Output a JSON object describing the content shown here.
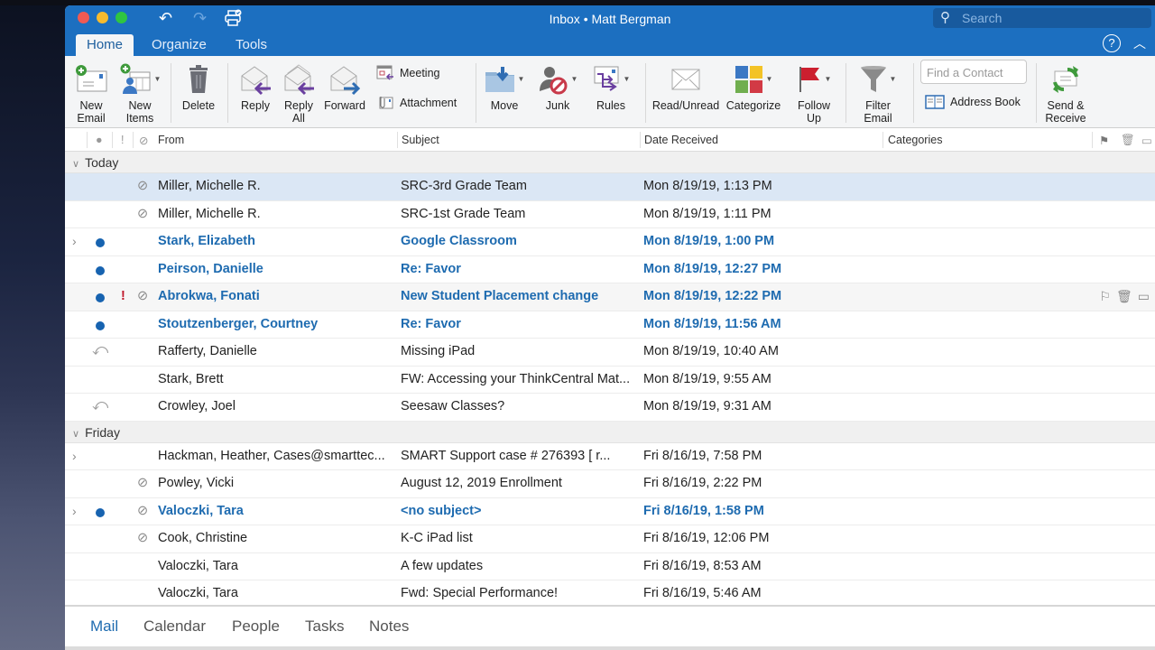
{
  "window": {
    "title": "Inbox • Matt Bergman",
    "search_placeholder": "Search"
  },
  "quick_access": {
    "undo_icon": "undo-icon",
    "redo_icon": "redo-icon",
    "print_icon": "print-icon"
  },
  "tabs": [
    {
      "label": "Home",
      "active": true
    },
    {
      "label": "Organize",
      "active": false
    },
    {
      "label": "Tools",
      "active": false
    }
  ],
  "ribbon": {
    "new_email": "New\nEmail",
    "new_items": "New\nItems",
    "delete": "Delete",
    "reply": "Reply",
    "reply_all": "Reply\nAll",
    "forward": "Forward",
    "meeting": "Meeting",
    "attachment": "Attachment",
    "move": "Move",
    "junk": "Junk",
    "rules": "Rules",
    "read_unread": "Read/Unread",
    "categorize": "Categorize",
    "follow_up": "Follow\nUp",
    "filter_email": "Filter\nEmail",
    "find_contact_placeholder": "Find a Contact",
    "address_book": "Address Book",
    "send_receive": "Send &\nReceive",
    "colors": {
      "category_blue": "#3b78c4",
      "category_yellow": "#f3c326",
      "category_green": "#70ae4f",
      "category_red": "#d23a45",
      "flag_red": "#cc1f2f",
      "reply_arrow": "#6a3fa0",
      "forward_arrow": "#2f6db3",
      "send_receive_green": "#3f9a3c"
    }
  },
  "list_header": {
    "unread_col": "●",
    "importance_col": "!",
    "attachment_col": "attachment-icon",
    "from": "From",
    "subject": "Subject",
    "date": "Date Received",
    "categories": "Categories"
  },
  "groups": [
    {
      "label": "Today",
      "messages": [
        {
          "from": "Miller, Michelle R.",
          "subject": "SRC-3rd Grade Team",
          "date": "Mon 8/19/19, 1:13 PM",
          "unread": false,
          "attachment": true,
          "important": false,
          "thread": false,
          "replied": false,
          "selected": true
        },
        {
          "from": "Miller, Michelle R.",
          "subject": "SRC-1st Grade Team",
          "date": "Mon 8/19/19, 1:11 PM",
          "unread": false,
          "attachment": true,
          "important": false,
          "thread": false,
          "replied": false
        },
        {
          "from": "Stark, Elizabeth",
          "subject": "Google Classroom",
          "date": "Mon 8/19/19, 1:00 PM",
          "unread": true,
          "attachment": false,
          "important": false,
          "thread": true,
          "replied": false
        },
        {
          "from": "Peirson, Danielle",
          "subject": "Re: Favor",
          "date": "Mon 8/19/19, 12:27 PM",
          "unread": true,
          "attachment": false,
          "important": false,
          "thread": false,
          "replied": false
        },
        {
          "from": "Abrokwa, Fonati",
          "subject": "New Student Placement change",
          "date": "Mon 8/19/19, 12:22 PM",
          "unread": true,
          "attachment": true,
          "important": true,
          "thread": false,
          "replied": false,
          "hover": true
        },
        {
          "from": "Stoutzenberger, Courtney",
          "subject": "Re: Favor",
          "date": "Mon 8/19/19, 11:56 AM",
          "unread": true,
          "attachment": false,
          "important": false,
          "thread": false,
          "replied": false
        },
        {
          "from": "Rafferty, Danielle",
          "subject": "Missing iPad",
          "date": "Mon 8/19/19, 10:40 AM",
          "unread": false,
          "attachment": false,
          "important": false,
          "thread": false,
          "replied": true
        },
        {
          "from": "Stark, Brett",
          "subject": "FW: Accessing your ThinkCentral Mat...",
          "date": "Mon 8/19/19, 9:55 AM",
          "unread": false,
          "attachment": false,
          "important": false,
          "thread": false,
          "replied": false
        },
        {
          "from": "Crowley, Joel",
          "subject": "Seesaw Classes?",
          "date": "Mon 8/19/19, 9:31 AM",
          "unread": false,
          "attachment": false,
          "important": false,
          "thread": false,
          "replied": true
        }
      ]
    },
    {
      "label": "Friday",
      "messages": [
        {
          "from": "Hackman, Heather, Cases@smarttec...",
          "subject": "SMART Support case # 276393    [ r...",
          "date": "Fri 8/16/19, 7:58 PM",
          "unread": false,
          "attachment": false,
          "important": false,
          "thread": true,
          "replied": false
        },
        {
          "from": "Powley, Vicki",
          "subject": "August 12, 2019 Enrollment",
          "date": "Fri 8/16/19, 2:22 PM",
          "unread": false,
          "attachment": true,
          "important": false,
          "thread": false,
          "replied": false
        },
        {
          "from": "Valoczki, Tara",
          "subject": "<no subject>",
          "date": "Fri 8/16/19, 1:58 PM",
          "unread": true,
          "attachment": true,
          "important": false,
          "thread": true,
          "replied": false
        },
        {
          "from": "Cook, Christine",
          "subject": "K-C iPad list",
          "date": "Fri 8/16/19, 12:06 PM",
          "unread": false,
          "attachment": true,
          "important": false,
          "thread": false,
          "replied": false
        },
        {
          "from": "Valoczki, Tara",
          "subject": "A few updates",
          "date": "Fri 8/16/19, 8:53 AM",
          "unread": false,
          "attachment": false,
          "important": false,
          "thread": false,
          "replied": false
        },
        {
          "from": "Valoczki, Tara",
          "subject": "Fwd: Special Performance!",
          "date": "Fri 8/16/19, 5:46 AM",
          "unread": false,
          "attachment": false,
          "important": false,
          "thread": false,
          "replied": false
        }
      ]
    }
  ],
  "navigation": [
    {
      "label": "Mail",
      "active": true
    },
    {
      "label": "Calendar",
      "active": false
    },
    {
      "label": "People",
      "active": false
    },
    {
      "label": "Tasks",
      "active": false
    },
    {
      "label": "Notes",
      "active": false
    }
  ],
  "colors": {
    "brand_blue": "#1c6fc0",
    "unread_blue": "#1e6bb0",
    "selected_row": "#dbe7f5",
    "importance_red": "#c0182b"
  }
}
